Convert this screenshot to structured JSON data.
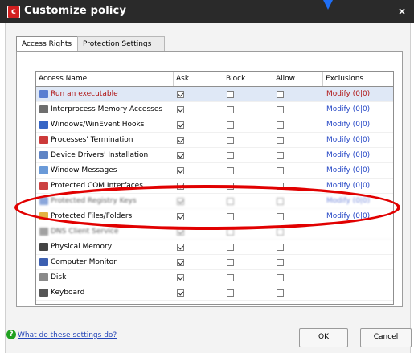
{
  "window": {
    "title": "Customize policy",
    "close": "×"
  },
  "tabs": [
    {
      "label": "Access Rights",
      "active": true
    },
    {
      "label": "Protection Settings",
      "active": false
    }
  ],
  "table": {
    "headers": [
      "Access Name",
      "Ask",
      "Block",
      "Allow",
      "Exclusions"
    ],
    "rows": [
      {
        "name": "Run an executable",
        "ask": true,
        "block": false,
        "allow": false,
        "exclusions": "Modify (0|0)",
        "icon": "executable-icon",
        "selected": true,
        "red": true
      },
      {
        "name": "Interprocess Memory Accesses",
        "ask": true,
        "block": false,
        "allow": false,
        "exclusions": "Modify (0|0)",
        "icon": "memory-access-icon"
      },
      {
        "name": "Windows/WinEvent Hooks",
        "ask": true,
        "block": false,
        "allow": false,
        "exclusions": "Modify (0|0)",
        "icon": "hooks-icon"
      },
      {
        "name": "Processes' Termination",
        "ask": true,
        "block": false,
        "allow": false,
        "exclusions": "Modify (0|0)",
        "icon": "termination-icon"
      },
      {
        "name": "Device Drivers' Installation",
        "ask": true,
        "block": false,
        "allow": false,
        "exclusions": "Modify (0|0)",
        "icon": "driver-icon"
      },
      {
        "name": "Window Messages",
        "ask": true,
        "block": false,
        "allow": false,
        "exclusions": "Modify (0|0)",
        "icon": "window-messages-icon"
      },
      {
        "name": "Protected COM Interfaces",
        "ask": true,
        "block": false,
        "allow": false,
        "exclusions": "Modify (0|0)",
        "icon": "com-interfaces-icon"
      },
      {
        "name": "Protected Registry Keys",
        "ask": true,
        "block": false,
        "allow": false,
        "exclusions": "Modify (0|0)",
        "icon": "registry-icon",
        "blur": true
      },
      {
        "name": "Protected Files/Folders",
        "ask": true,
        "block": false,
        "allow": false,
        "exclusions": "Modify (0|0)",
        "icon": "folder-icon"
      },
      {
        "name": "DNS Client Service",
        "ask": true,
        "block": false,
        "allow": false,
        "exclusions": "",
        "icon": "dns-icon",
        "blur": true
      },
      {
        "name": "Physical Memory",
        "ask": true,
        "block": false,
        "allow": false,
        "exclusions": "",
        "icon": "physical-memory-icon"
      },
      {
        "name": "Computer Monitor",
        "ask": true,
        "block": false,
        "allow": false,
        "exclusions": "",
        "icon": "monitor-icon"
      },
      {
        "name": "Disk",
        "ask": true,
        "block": false,
        "allow": false,
        "exclusions": "",
        "icon": "disk-icon"
      },
      {
        "name": "Keyboard",
        "ask": true,
        "block": false,
        "allow": false,
        "exclusions": "",
        "icon": "keyboard-icon"
      }
    ]
  },
  "footer": {
    "help_link": "What do these settings do?",
    "ok": "OK",
    "cancel": "Cancel"
  },
  "colors": {
    "titlebar": "#2a2a2a",
    "app_logo": "#d21f1f",
    "accent_blue": "#2547c6",
    "highlight_red": "#e10000",
    "selected_row": "#dfe8f6"
  }
}
